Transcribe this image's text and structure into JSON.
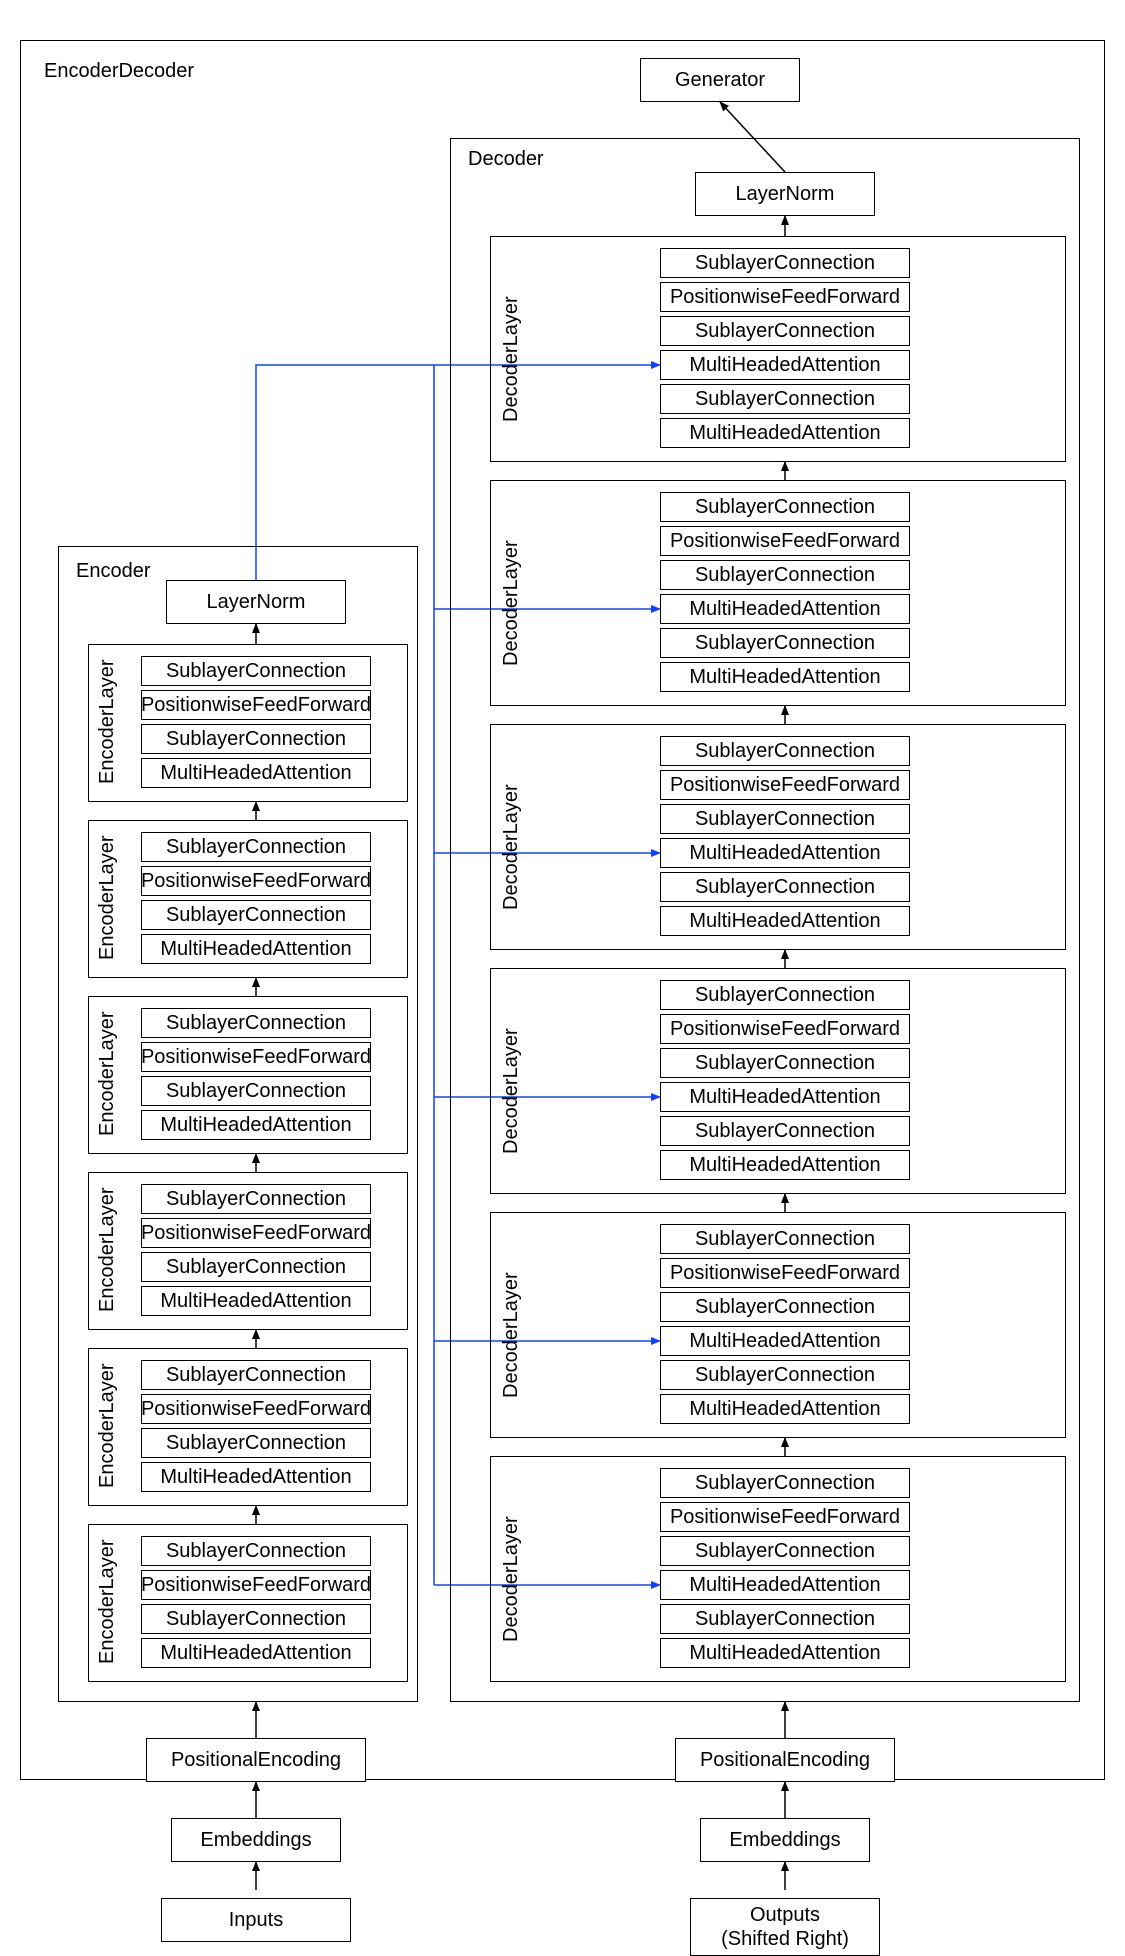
{
  "title": "EncoderDecoder",
  "generator": "Generator",
  "encoder": {
    "label": "Encoder",
    "layernorm": "LayerNorm",
    "layer_label": "EncoderLayer",
    "blocks": [
      "SublayerConnection",
      "PositionwiseFeedForward",
      "SublayerConnection",
      "MultiHeadedAttention"
    ],
    "posenc": "PositionalEncoding",
    "embed": "Embeddings",
    "input": "Inputs"
  },
  "decoder": {
    "label": "Decoder",
    "layernorm": "LayerNorm",
    "layer_label": "DecoderLayer",
    "blocks": [
      "SublayerConnection",
      "PositionwiseFeedForward",
      "SublayerConnection",
      "MultiHeadedAttention",
      "SublayerConnection",
      "MultiHeadedAttention"
    ],
    "posenc": "PositionalEncoding",
    "embed": "Embeddings",
    "input": "Outputs\n(Shifted Right)"
  },
  "layout": {
    "colors": {
      "stroke": "#000000",
      "cross": "#1040ff"
    },
    "num_encoder_layers": 6,
    "num_decoder_layers": 6
  }
}
